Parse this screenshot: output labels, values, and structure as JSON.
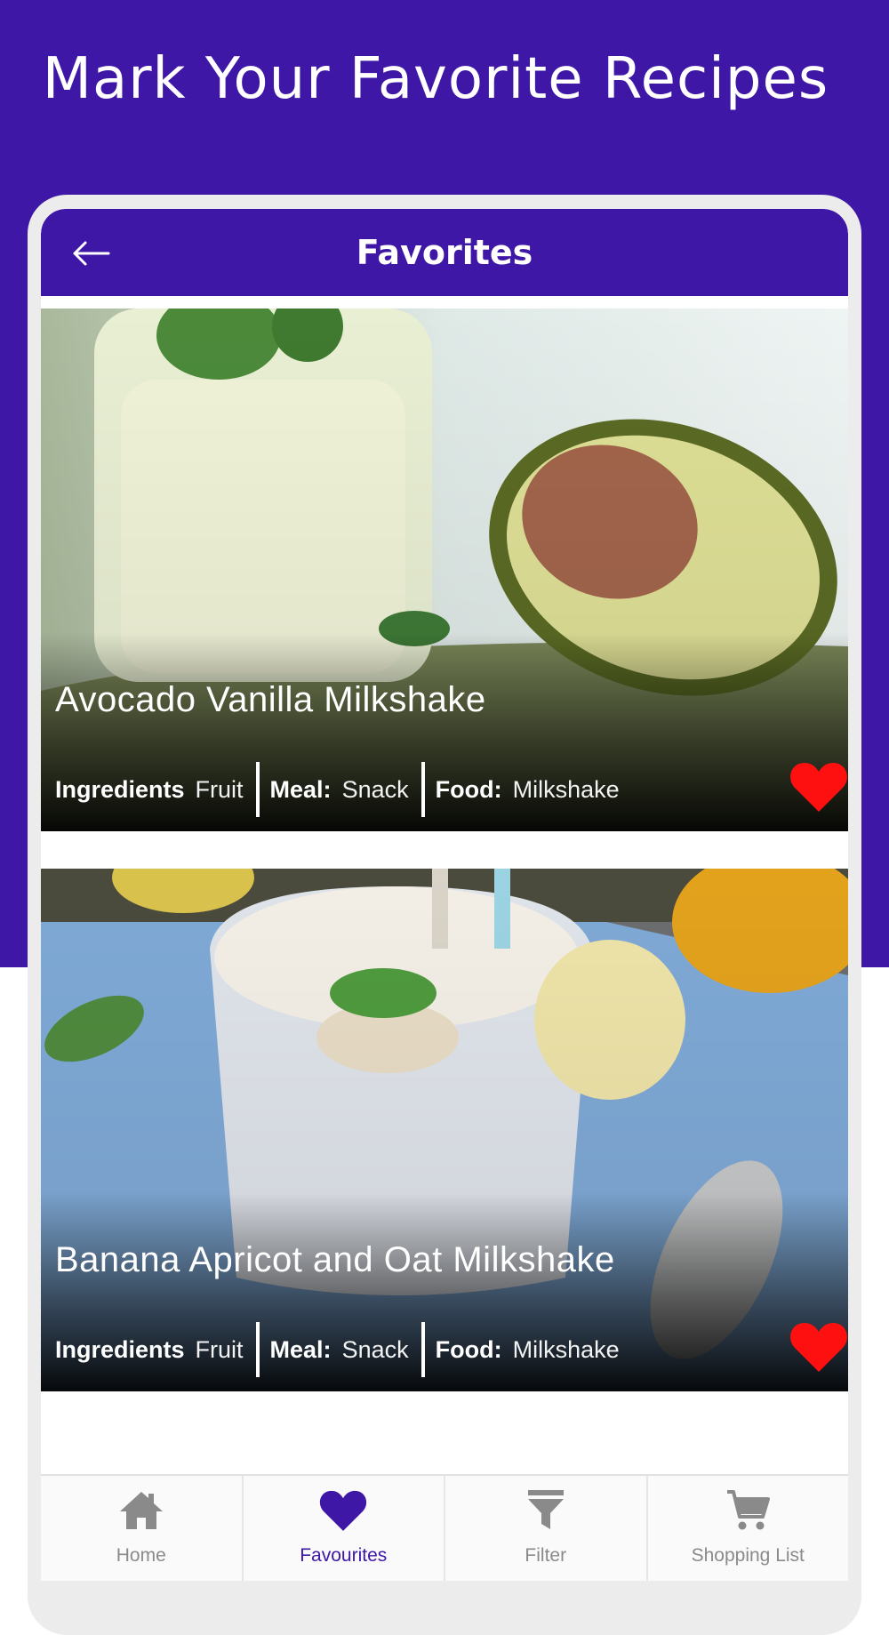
{
  "promo": {
    "title": "Mark Your Favorite Recipes"
  },
  "colors": {
    "brand": "#3f17a6",
    "heart": "#ff1010",
    "nav_inactive": "#8a8a8a"
  },
  "appbar": {
    "title": "Favorites",
    "back_icon": "arrow-left-icon"
  },
  "recipes": [
    {
      "title": "Avocado Vanilla Milkshake",
      "ingredients_label": "Ingredients",
      "ingredients_value": "Fruit",
      "meal_label": "Meal:",
      "meal_value": "Snack",
      "food_label": "Food:",
      "food_value": "Milkshake",
      "favorite_icon": "heart-icon"
    },
    {
      "title": "Banana Apricot and Oat Milkshake",
      "ingredients_label": "Ingredients",
      "ingredients_value": "Fruit",
      "meal_label": "Meal:",
      "meal_value": "Snack",
      "food_label": "Food:",
      "food_value": "Milkshake",
      "favorite_icon": "heart-icon"
    }
  ],
  "bottom_nav": [
    {
      "label": "Home",
      "icon": "home-icon",
      "active": false
    },
    {
      "label": "Favourites",
      "icon": "heart-icon",
      "active": true
    },
    {
      "label": "Filter",
      "icon": "filter-icon",
      "active": false
    },
    {
      "label": "Shopping List",
      "icon": "cart-icon",
      "active": false
    }
  ]
}
